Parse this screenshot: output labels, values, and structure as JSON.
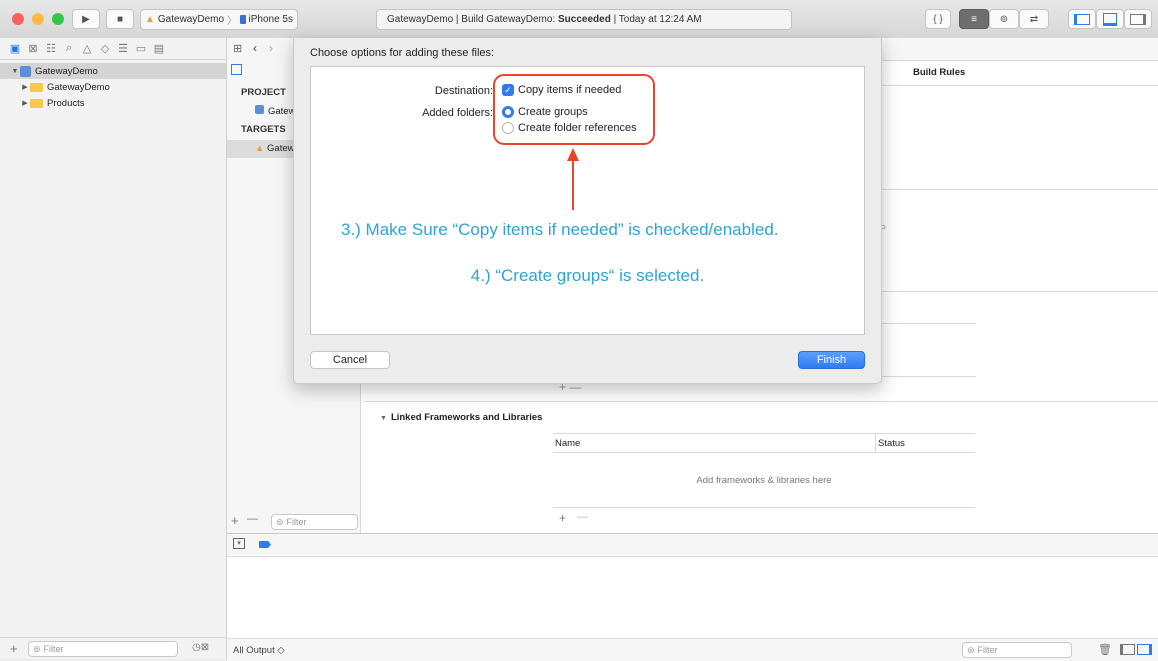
{
  "toolbar": {
    "scheme_target": "GatewayDemo",
    "scheme_device": "iPhone 5s",
    "activity_prefix": "GatewayDemo | Build GatewayDemo: ",
    "activity_status": "Succeeded",
    "activity_time": " | Today at 12:24 AM",
    "braces": "{ }"
  },
  "navigator": {
    "items": [
      {
        "label": "GatewayDemo"
      },
      {
        "label": "GatewayDemo"
      },
      {
        "label": "Products"
      }
    ],
    "filter_placeholder": "Filter"
  },
  "editor": {
    "project_header": "PROJECT",
    "project_item": "Gatew",
    "targets_header": "TARGETS",
    "target_item": "Gatew",
    "build_rules": "Build Rules",
    "linked_section": "Linked Frameworks and Libraries",
    "col_name": "Name",
    "col_status": "Status",
    "empty_msg": "Add frameworks & libraries here",
    "filter_placeholder": "Filter",
    "plus": "+",
    "minus": "—"
  },
  "debug": {
    "output_label": "All Output ◇",
    "filter_placeholder": "Filter"
  },
  "sheet": {
    "title": "Choose options for adding these files:",
    "destination_label": "Destination:",
    "copy_items_label": "Copy items if needed",
    "added_folders_label": "Added folders:",
    "create_groups_label": "Create groups",
    "folder_refs_label": "Create folder references",
    "annotation_1": "3.) Make Sure “Copy items if needed” is checked/enabled.",
    "annotation_2": "4.) “Create groups“ is selected.",
    "cancel": "Cancel",
    "finish": "Finish"
  },
  "colors": {
    "accent": "#2f7bf0",
    "annotation": "#2ea3d8",
    "highlight": "#e8452c"
  }
}
